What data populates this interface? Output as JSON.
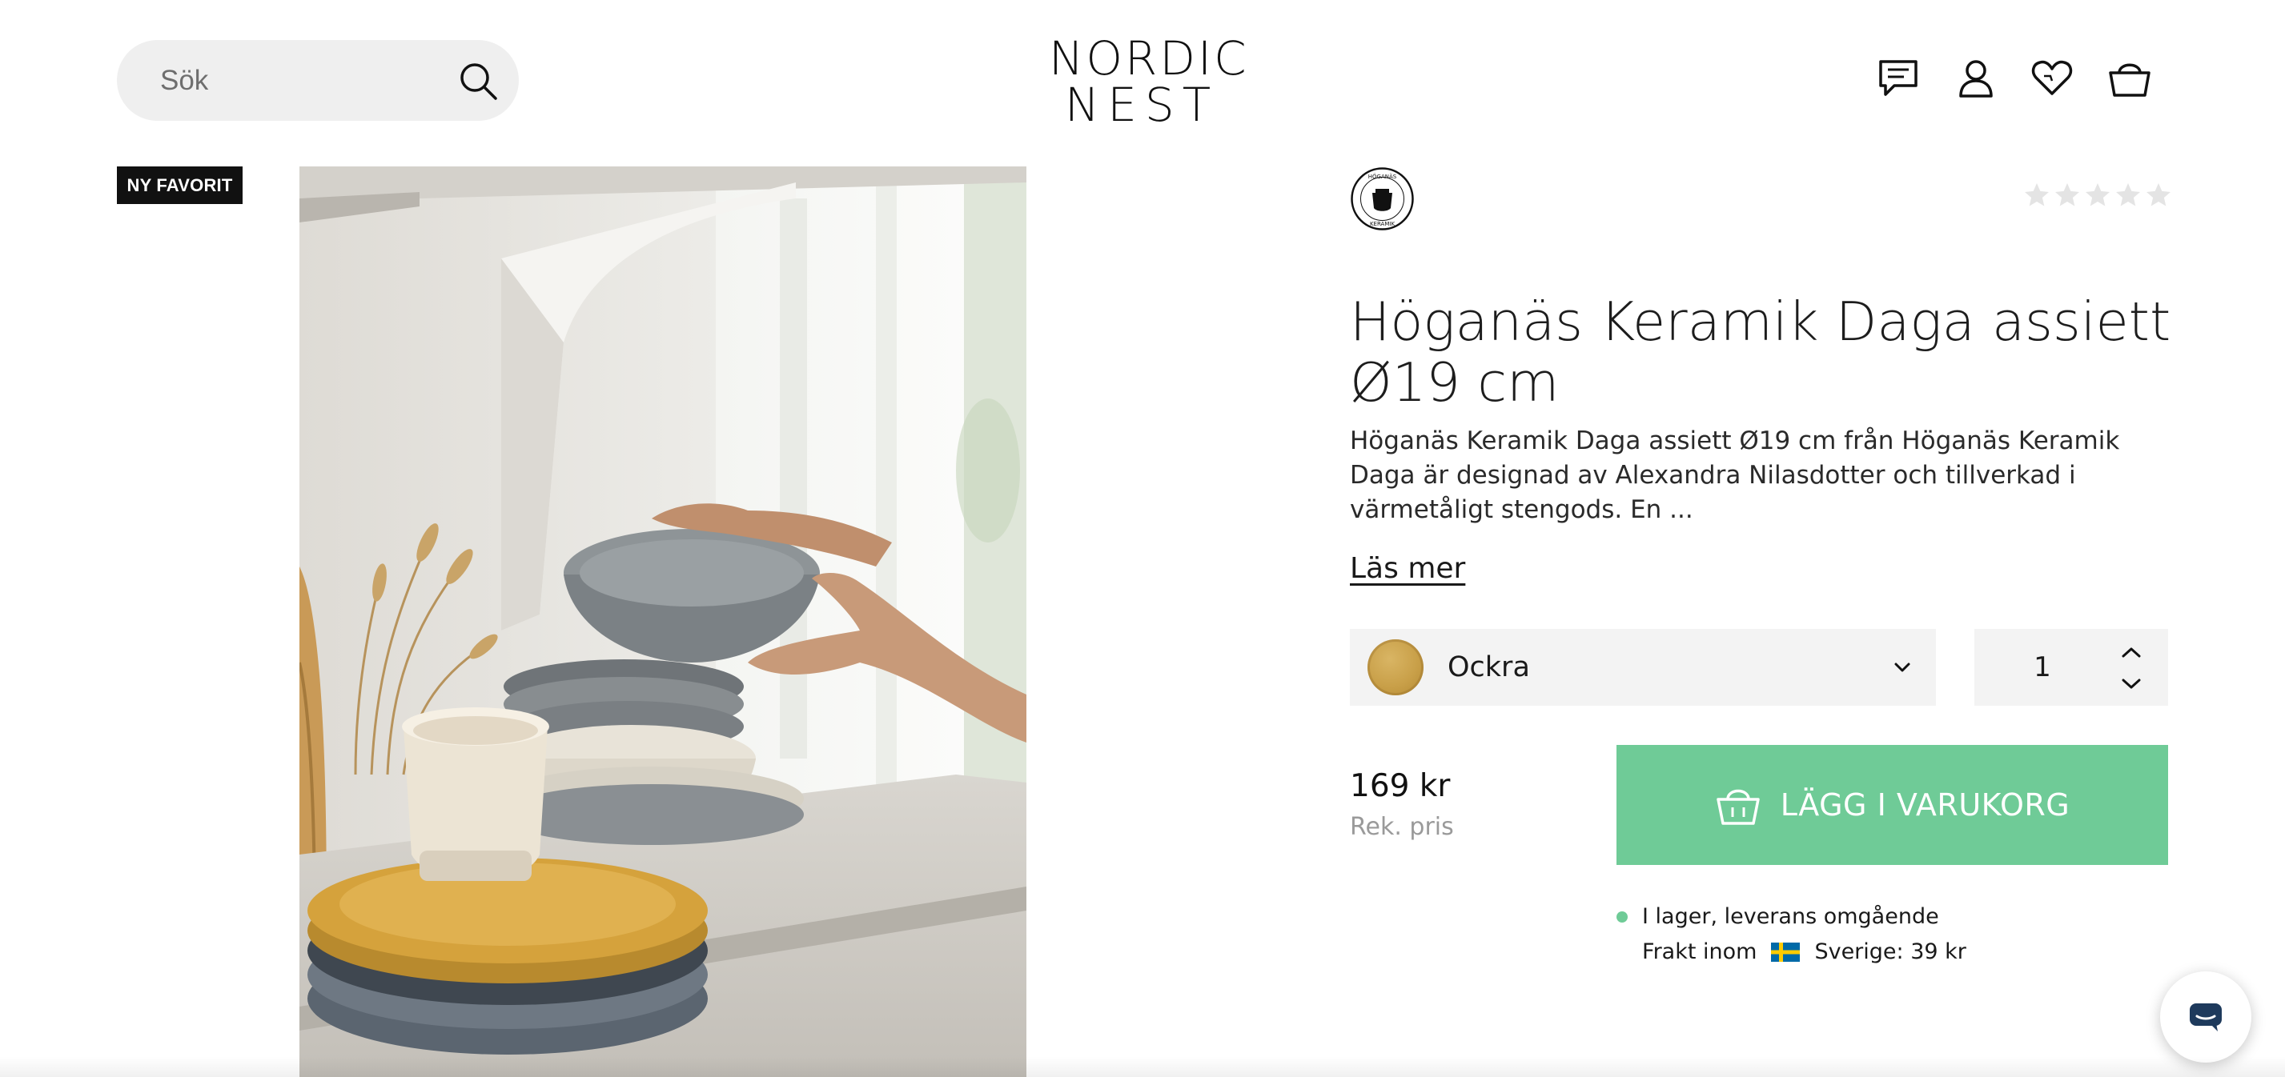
{
  "header": {
    "search_placeholder": "Sök",
    "logo_line1": "NORDIC",
    "logo_line2": "NEST",
    "icons": [
      "chat-icon",
      "account-icon",
      "wishlist-heart-icon",
      "basket-icon"
    ]
  },
  "gallery": {
    "badge": "NY FAVORIT"
  },
  "product": {
    "brand_logo_text": "HÖGANÄS KERAMIK",
    "rating_stars_filled": 0,
    "rating_stars_total": 5,
    "title": "Höganäs Keramik Daga assiett Ø19 cm",
    "description": "Höganäs Keramik Daga assiett Ø19 cm från Höganäs Keramik Daga är designad av Alexandra Nilasdotter och tillverkad i värmetåligt stengods. En ...",
    "read_more": "Läs mer",
    "variant_label": "Ockra",
    "quantity": "1",
    "price": "169 kr",
    "price_note": "Rek. pris",
    "add_to_cart": "LÄGG I VARUKORG",
    "stock_status": "I lager, leverans omgående",
    "shipping_label": "Frakt inom",
    "shipping_value": "Sverige: 39 kr"
  },
  "colors": {
    "accent_green": "#6fcb97",
    "badge_bg": "#111111",
    "swatch_ochre": "#c9a049"
  }
}
